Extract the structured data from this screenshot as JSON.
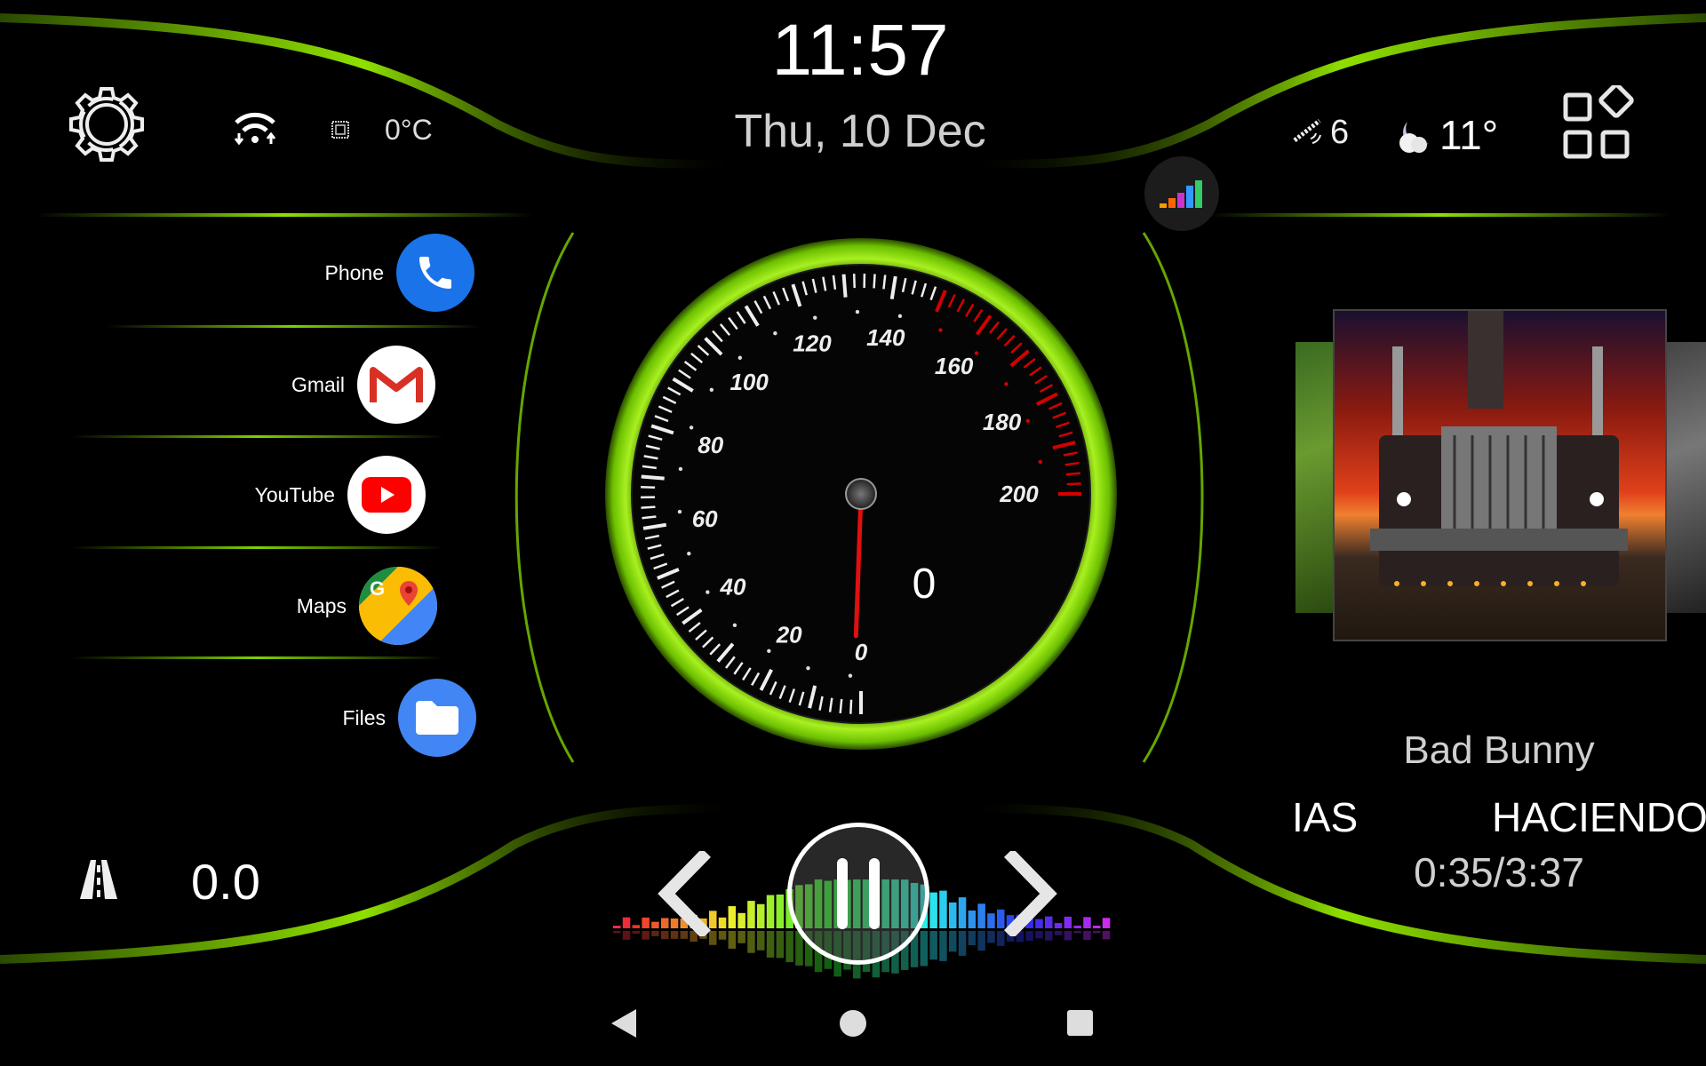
{
  "status_bar": {
    "time": "11:57",
    "date": "Thu, 10 Dec",
    "cpu_temp": "0°C",
    "gps_satellites": "6",
    "weather_temp": "11°"
  },
  "apps": [
    {
      "label": "Phone",
      "icon": "phone-icon",
      "color": "#1a73e8"
    },
    {
      "label": "Gmail",
      "icon": "gmail-icon",
      "color": "#ffffff"
    },
    {
      "label": "YouTube",
      "icon": "youtube-icon",
      "color": "#ffffff"
    },
    {
      "label": "Maps",
      "icon": "maps-icon",
      "color": "#ffffff"
    },
    {
      "label": "Files",
      "icon": "files-icon",
      "color": "#4285f4"
    }
  ],
  "speedometer": {
    "min": 0,
    "max": 200,
    "labels": [
      "0",
      "20",
      "40",
      "60",
      "80",
      "100",
      "120",
      "140",
      "160",
      "180",
      "200"
    ],
    "redline_from": 150,
    "value": 0,
    "speed_display": "0"
  },
  "trip": {
    "distance": "0.0"
  },
  "media": {
    "artist": "Bad Bunny",
    "title_left": "IAS",
    "title_right": "HACIENDO",
    "progress": "0:35/3:37",
    "state": "playing"
  },
  "colors": {
    "accent": "#7ed000",
    "redline": "#d40000",
    "needle": "#e01010"
  }
}
